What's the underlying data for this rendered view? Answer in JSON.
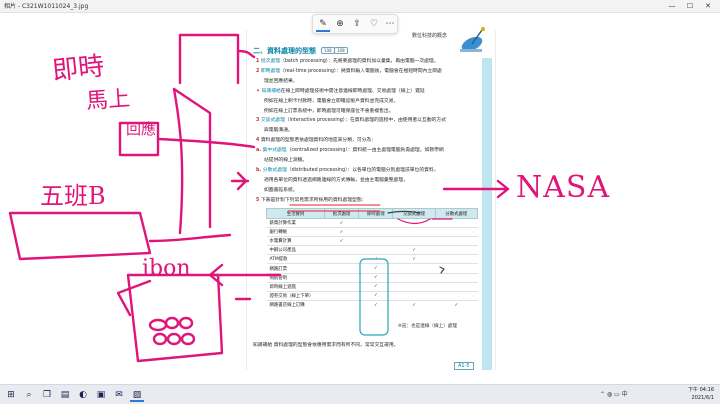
{
  "window": {
    "title": "相片 - C321W1011024_3.jpg",
    "controls": {
      "minimize": "—",
      "maximize": "☐",
      "close": "✕"
    }
  },
  "toolbar": {
    "buttons": [
      {
        "name": "draw",
        "glyph": "✎"
      },
      {
        "name": "zoom",
        "glyph": "⊕"
      },
      {
        "name": "share",
        "glyph": "⇪"
      },
      {
        "name": "favorite",
        "glyph": "♡"
      },
      {
        "name": "more",
        "glyph": "⋯"
      }
    ]
  },
  "document": {
    "chapter_tag": "數位科技的概念",
    "section_title": "二、資料處理的型態",
    "section_tags": [
      "108",
      "108"
    ],
    "items": [
      {
        "num": "1",
        "term": "批次處理",
        "text": "（batch processing）：先將要處理的資料加以彙集，再由電腦一次處理。"
      },
      {
        "num": "2",
        "term": "即時處理",
        "text": "（real-time processing）：將資料輸入電腦後，電腦會在極短時間內立即處"
      },
      {
        "num": "",
        "term": "",
        "text": "理並回應結果。"
      },
      {
        "num": "✦",
        "term": "知識補給",
        "text": "在線上即時處理技術中需注意連線即時處理、交易處理（線上）遲延"
      },
      {
        "num": "",
        "term": "",
        "text": "例如在線上刷卡付款時，電腦會立即確認帳戶資料並完成交易。"
      },
      {
        "num": "",
        "term": "",
        "text": "例如在線上訂票系統中，即時處理可確保座位不會重複售出。"
      },
      {
        "num": "3",
        "term": "交談式處理",
        "text": "（interactive processing）：在資料處理的過程中，由使用者以互動的方式"
      },
      {
        "num": "",
        "term": "",
        "text": "與電腦溝通。"
      },
      {
        "num": "4",
        "term": "",
        "text": "資料處理的型態若依處理資料的地區來分類，可分為："
      },
      {
        "num": "a.",
        "term": "集中式處理",
        "text": "（centralized processing）：資料統一由主處理電腦負責處理，如教學網"
      },
      {
        "num": "",
        "term": "",
        "text": "站提供的線上測驗。"
      },
      {
        "num": "b.",
        "term": "分散式處理",
        "text": "（distributed processing）：以各單位的電腦分別處理該單位的資料，"
      },
      {
        "num": "",
        "term": "",
        "text": "適用各單位的資料透過網路連線的方式傳輸，並由主電腦彙整處理，"
      },
      {
        "num": "",
        "term": "",
        "text": "如圖書館系統。"
      },
      {
        "num": "5",
        "term": "",
        "text": "下表是針對下列常見需求所採用的資料處理型態："
      }
    ],
    "table": {
      "headers": [
        "生活實例",
        "批次處理",
        "即時處理",
        "交談式處理",
        "分散式處理"
      ],
      "rows": [
        {
          "name": "薪資計算作業",
          "marks": [
            "✓",
            "",
            "",
            ""
          ]
        },
        {
          "name": "銀行轉帳",
          "marks": [
            "✓",
            "",
            "",
            ""
          ]
        },
        {
          "name": "水電費計算",
          "marks": [
            "✓",
            "",
            "",
            ""
          ]
        },
        {
          "name": "中鋼公司產品",
          "marks": [
            "",
            "",
            "✓",
            ""
          ]
        },
        {
          "name": "ATM提款",
          "marks": [
            "",
            "✓",
            "✓",
            ""
          ]
        },
        {
          "name": "網路訂票",
          "marks": [
            "",
            "✓",
            "",
            ""
          ]
        },
        {
          "name": "飛航管制",
          "marks": [
            "",
            "✓",
            "",
            ""
          ]
        },
        {
          "name": "即時線上遊戲",
          "marks": [
            "",
            "✓",
            "",
            ""
          ]
        },
        {
          "name": "證券交易（線上下單）",
          "marks": [
            "",
            "✓",
            "",
            ""
          ]
        },
        {
          "name": "網路書店線上訂購",
          "marks": [
            "",
            "✓",
            "✓",
            "✓"
          ]
        }
      ]
    },
    "legend": "※註：也是連線（線上）處理",
    "bottom_note": "知識補給  資料處理的型態會依應用需求而有所不同，常常交互運用。",
    "page_number": "A1-5"
  },
  "annotations": {
    "immediate": "即時",
    "immediately": "馬上",
    "class_b": "五班B",
    "ibon": "ibon",
    "nasa": "NASA"
  },
  "taskbar": {
    "search": "⌕",
    "icons": [
      {
        "name": "start",
        "glyph": "⊞"
      },
      {
        "name": "task-view",
        "glyph": "❐"
      },
      {
        "name": "explorer",
        "glyph": "▤"
      },
      {
        "name": "edge",
        "glyph": "◐"
      },
      {
        "name": "store",
        "glyph": "▣"
      },
      {
        "name": "mail",
        "glyph": "✉"
      },
      {
        "name": "photos",
        "glyph": "▨"
      }
    ],
    "tray": "⌃  ◍  ▭  中",
    "time": "下午 04:16",
    "date": "2021/6/1"
  }
}
